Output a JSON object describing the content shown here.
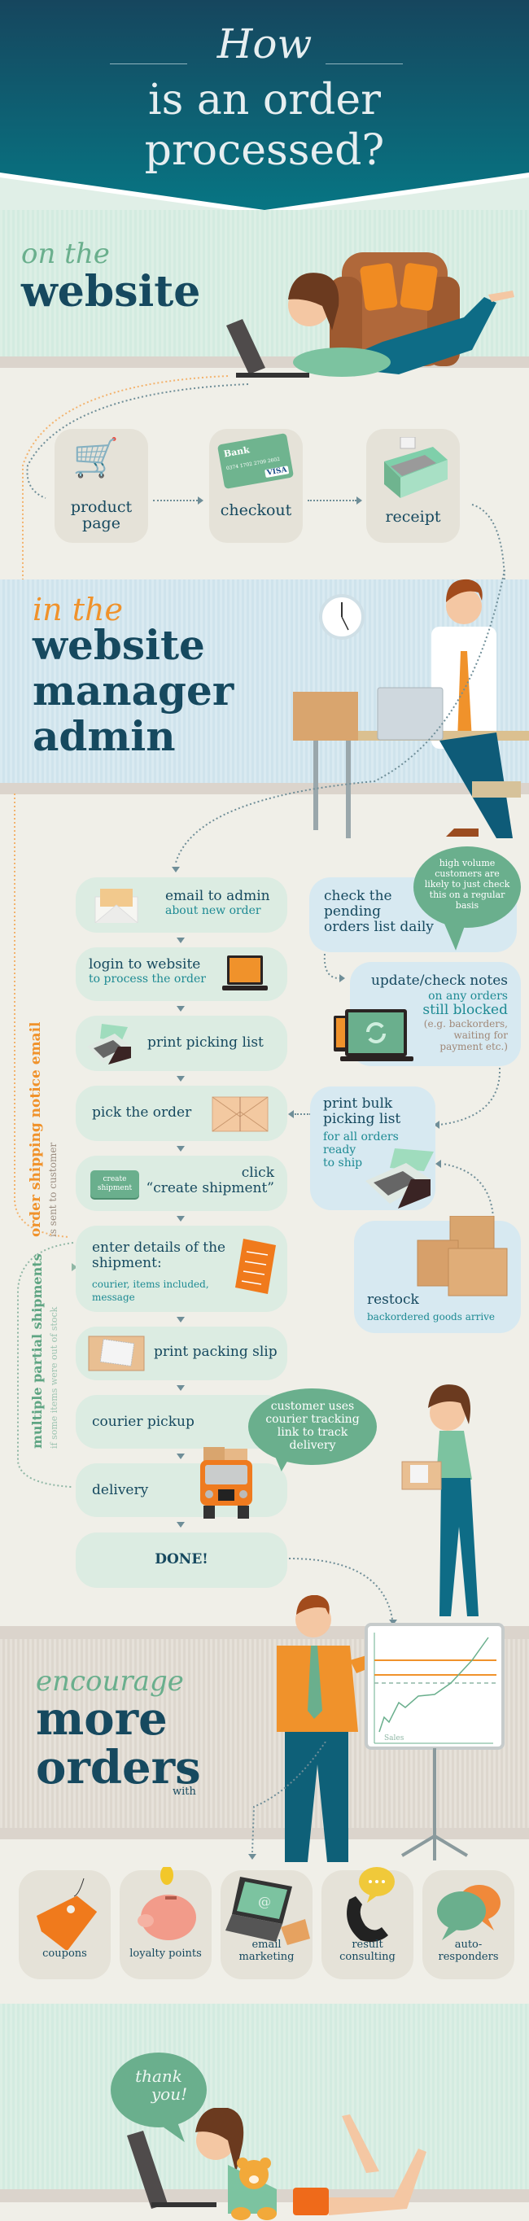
{
  "header": {
    "script_word": "How",
    "title_line1": "is an order",
    "title_line2": "processed?"
  },
  "website_section": {
    "script": "on the",
    "heading": "website",
    "steps": [
      {
        "label_line1": "product",
        "label_line2": "page",
        "icon": "shopping-cart-teddy-icon"
      },
      {
        "label_line1": "checkout",
        "label_line2": "",
        "icon": "credit-card-icon",
        "card_bank": "Bank",
        "card_brand": "VISA",
        "card_number": "0374 1702 2709 2602"
      },
      {
        "label_line1": "receipt",
        "label_line2": "",
        "icon": "cash-register-icon"
      }
    ]
  },
  "admin_section": {
    "script": "in the",
    "heading_line1": "website",
    "heading_line2": "manager",
    "heading_line3": "admin"
  },
  "flow": {
    "main": [
      {
        "title": "email to admin",
        "sub": "about new order",
        "icon": "envelope-icon"
      },
      {
        "title": "login to website",
        "sub": "to process the order",
        "icon": "laptop-icon"
      },
      {
        "title": "print picking list",
        "sub": "",
        "icon": "printer-icon"
      },
      {
        "title": "pick the order",
        "sub": "",
        "icon": "package-icon"
      },
      {
        "title": "click",
        "sub": "“create shipment”",
        "icon": "create-shipment-button-icon",
        "button_line1": "create",
        "button_line2": "shipment"
      },
      {
        "title_line1": "enter details of the",
        "title_line2": "shipment:",
        "sub_line1": "courier, items included,",
        "sub_line2": "message",
        "icon": "checklist-icon"
      },
      {
        "title": "print packing slip",
        "sub": "",
        "icon": "parcel-slip-icon"
      },
      {
        "title": "courier pickup",
        "sub": ""
      },
      {
        "title": "delivery",
        "sub": "",
        "icon": "delivery-truck-icon"
      },
      {
        "title": "DONE!",
        "sub": ""
      }
    ],
    "side": {
      "pending": {
        "line1": "check the",
        "line2": "pending",
        "line3": "orders list daily"
      },
      "pending_bubble": {
        "line1": "high volume",
        "line2": "customers are",
        "line3": "likely to just check",
        "line4": "this on a regular",
        "line5": "basis"
      },
      "notes": {
        "title": "update/check notes",
        "sub1": "on any orders",
        "sub2": "still blocked",
        "note1": "(e.g. backorders,",
        "note2": "waiting for",
        "note3": "payment etc.)"
      },
      "bulk": {
        "line1": "print bulk",
        "line2": "picking list",
        "sub1": "for all orders",
        "sub2": "ready",
        "sub3": "to ship"
      },
      "restock": {
        "title": "restock",
        "sub": "backordered goods arrive"
      },
      "tracking_bubble": {
        "line1": "customer uses",
        "line2": "courier tracking",
        "line3": "link to track",
        "line4": "delivery"
      }
    },
    "vertical_notes": {
      "shipping_email_title": "order shipping notice email",
      "shipping_email_sub": "is sent to customer",
      "partial_title": "multiple partial shipments",
      "partial_sub": "if some items were out of stock"
    }
  },
  "encourage_section": {
    "script": "encourage",
    "heading_line1": "more",
    "heading_line2": "orders",
    "with": "with",
    "chart_label": "Sales",
    "tools": [
      {
        "label_line1": "coupons",
        "label_line2": "",
        "icon": "price-tag-icon"
      },
      {
        "label_line1": "loyalty points",
        "label_line2": "",
        "icon": "piggy-bank-icon"
      },
      {
        "label_line1": "email",
        "label_line2": "marketing",
        "icon": "email-laptop-icon"
      },
      {
        "label_line1": "result",
        "label_line2": "consulting",
        "icon": "telephone-icon"
      },
      {
        "label_line1": "auto-",
        "label_line2": "responders",
        "icon": "speech-bubbles-icon"
      }
    ]
  },
  "thanks": {
    "line1": "thank",
    "line2": "you!"
  },
  "colors": {
    "header_top": "#16465e",
    "header_bottom": "#077684",
    "navy_text": "#16495f",
    "teal_text": "#1d8a93",
    "orange_accent": "#f0922b",
    "green_accent": "#6aaf8d",
    "flow_box_green": "#dcece2",
    "flow_box_blue": "#d7e9f1",
    "page_bg": "#f0efe8"
  }
}
